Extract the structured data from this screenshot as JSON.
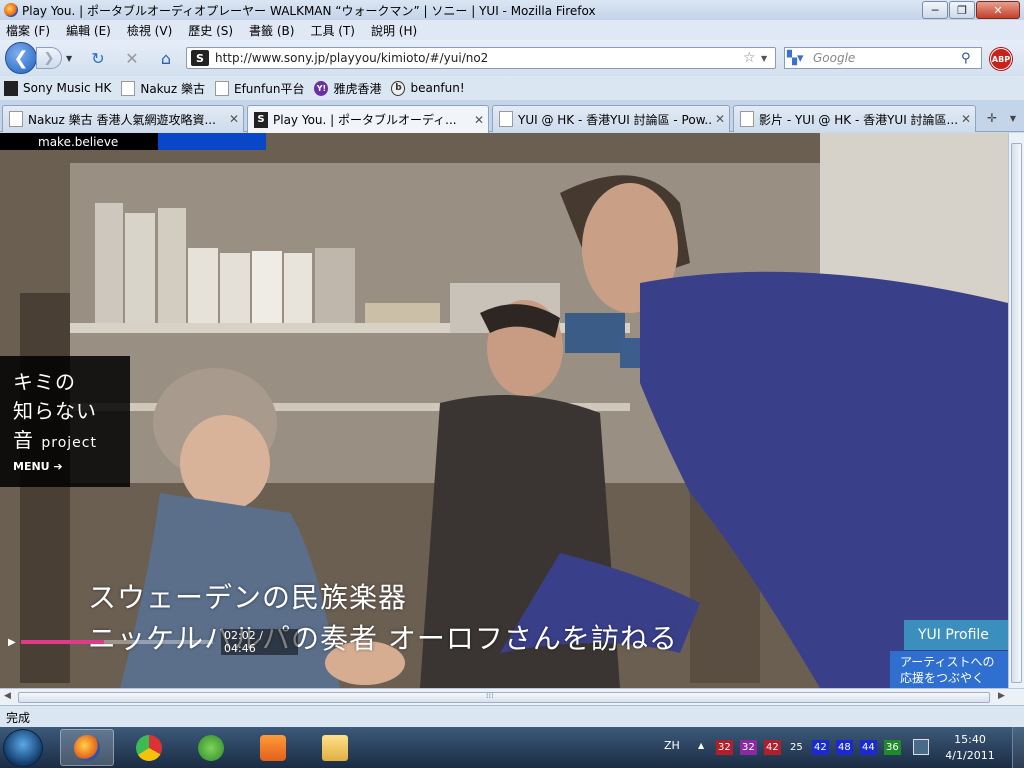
{
  "window": {
    "title": "Play You. | ポータブルオーディオプレーヤー WALKMAN “ウォークマン” | ソニー | YUI - Mozilla Firefox",
    "minimize": "─",
    "maximize": "❐",
    "close": "✕"
  },
  "menu": [
    "檔案 (F)",
    "編輯 (E)",
    "檢視 (V)",
    "歷史 (S)",
    "書籤 (B)",
    "工具 (T)",
    "說明 (H)"
  ],
  "nav": {
    "url": "http://www.sony.jp/playyou/kimioto/#/yui/no2",
    "search_placeholder": "Google",
    "abp": "ABP"
  },
  "bookmarks": [
    "Sony Music HK",
    "Nakuz 樂古",
    "Efunfun平台",
    "雅虎香港",
    "beanfun!"
  ],
  "tabs": [
    {
      "label": "Nakuz 樂古 香港人氣網遊攻略資...",
      "active": false
    },
    {
      "label": "Play You. | ポータブルオーディ...",
      "active": true
    },
    {
      "label": "YUI @ HK - 香港YUI 討論區 - Pow...",
      "active": false
    },
    {
      "label": "影片 - YUI @ HK - 香港YUI 討論區...",
      "active": false
    }
  ],
  "page": {
    "brand": "make.believe",
    "menu_box": {
      "line1": "キミの",
      "line2": "知らない",
      "line3": "音",
      "line3_small": "project",
      "menu_link": "MENU ➔"
    },
    "subtitle_line1": "スウェーデンの民族楽器",
    "subtitle_line2": "ニッケルハルパの奏者 オーロフさんを訪ねる",
    "player": {
      "time": "02:02 / 04:46",
      "progress": 0.43
    },
    "yui_profile": "YUI Profile",
    "cheer_line1": "アーティストへの",
    "cheer_line2": "応援をつぶやく"
  },
  "status": "完成",
  "taskbar": {
    "lang": "ZH",
    "badges": [
      {
        "v": "32",
        "c": "#b0202a"
      },
      {
        "v": "32",
        "c": "#8a2aa0"
      },
      {
        "v": "42",
        "c": "#b0202a"
      },
      {
        "v": "25",
        "c": ""
      },
      {
        "v": "42",
        "c": "#1a2ad0"
      },
      {
        "v": "48",
        "c": "#1a2ad0"
      },
      {
        "v": "44",
        "c": "#1a2ad0"
      },
      {
        "v": "36",
        "c": "#1e8a2a"
      }
    ],
    "time": "15:40",
    "date": "4/1/2011"
  }
}
